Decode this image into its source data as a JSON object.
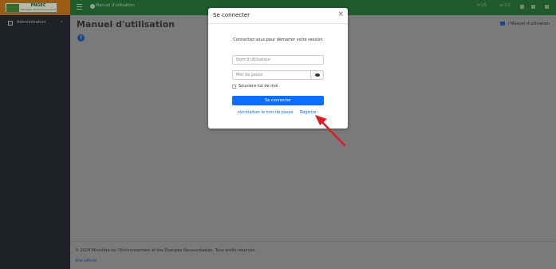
{
  "colors": {
    "sidebar_bg": "#1e2226",
    "topbar_bg": "#1f5a2c",
    "brand_bg": "#9a5c12",
    "primary": "#0d6efd",
    "annotation": "#e01b24"
  },
  "brand": {
    "logo_title": "PNGEC",
    "logo_subtitle": "Ministère de l'Environnement"
  },
  "sidebar": {
    "items": [
      {
        "label": "Administration",
        "icon": "folder-icon",
        "chevron": "‹"
      }
    ]
  },
  "topbar": {
    "title": "Manuel d'utilisation",
    "right_items": [
      "fr-US",
      "ar-DZ"
    ]
  },
  "page": {
    "title": "Manuel d'utilisation",
    "help_icon": "?",
    "breadcrumb": {
      "separator": "/",
      "current": "Manuel d'utilisation"
    }
  },
  "modal": {
    "title": "Se connecter",
    "close_label": "×",
    "intro": "Connectez-vous pour démarrer votre session",
    "username_placeholder": "Nom d'utilisateur",
    "password_placeholder": "Mot de passe",
    "remember_label": "Souviens-toi de moi",
    "login_label": "Se connecter",
    "reset_link": "réinitialiser le mot de passe",
    "register_link": "Registre"
  },
  "footer": {
    "copyright": "© 2024 Ministère de l'Environnement et des Energies Renouvelables. Tous droits réservés.",
    "site_link": "Site officiel"
  }
}
